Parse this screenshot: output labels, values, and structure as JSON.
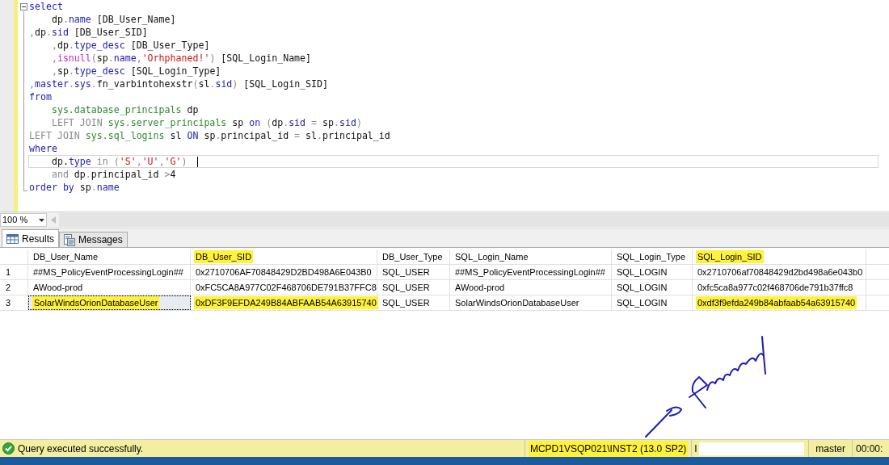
{
  "editor": {
    "lines": [
      {
        "current": false,
        "tokens": [
          {
            "kind": "keyword",
            "text": "select"
          }
        ]
      },
      {
        "current": false,
        "tokens": [
          {
            "kind": "plain",
            "text": "    dp"
          },
          {
            "kind": "gray",
            "text": "."
          },
          {
            "kind": "keyword",
            "text": "name"
          },
          {
            "kind": "plain",
            "text": " [DB_User_Name]"
          }
        ]
      },
      {
        "current": false,
        "tokens": [
          {
            "kind": "gray",
            "text": ","
          },
          {
            "kind": "plain",
            "text": "dp"
          },
          {
            "kind": "gray",
            "text": "."
          },
          {
            "kind": "keyword",
            "text": "sid"
          },
          {
            "kind": "plain",
            "text": " [DB_User_SID]"
          }
        ]
      },
      {
        "current": false,
        "tokens": [
          {
            "kind": "gray",
            "text": "    ,"
          },
          {
            "kind": "plain",
            "text": "dp"
          },
          {
            "kind": "gray",
            "text": "."
          },
          {
            "kind": "keyword",
            "text": "type_desc"
          },
          {
            "kind": "plain",
            "text": " [DB_User_Type]"
          }
        ]
      },
      {
        "current": false,
        "tokens": [
          {
            "kind": "gray",
            "text": "    ,"
          },
          {
            "kind": "function",
            "text": "isnull"
          },
          {
            "kind": "gray",
            "text": "("
          },
          {
            "kind": "plain",
            "text": "sp"
          },
          {
            "kind": "gray",
            "text": "."
          },
          {
            "kind": "keyword",
            "text": "name"
          },
          {
            "kind": "gray",
            "text": ","
          },
          {
            "kind": "string",
            "text": "'Orhphaned!'"
          },
          {
            "kind": "gray",
            "text": ")"
          },
          {
            "kind": "plain",
            "text": " [SQL_Login_Name]"
          }
        ]
      },
      {
        "current": false,
        "tokens": [
          {
            "kind": "gray",
            "text": "    ,"
          },
          {
            "kind": "plain",
            "text": "sp"
          },
          {
            "kind": "gray",
            "text": "."
          },
          {
            "kind": "keyword",
            "text": "type_desc"
          },
          {
            "kind": "plain",
            "text": " [SQL_Login_Type]"
          }
        ]
      },
      {
        "current": false,
        "tokens": [
          {
            "kind": "gray",
            "text": ","
          },
          {
            "kind": "keyword",
            "text": "master"
          },
          {
            "kind": "gray",
            "text": "."
          },
          {
            "kind": "keyword",
            "text": "sys"
          },
          {
            "kind": "gray",
            "text": "."
          },
          {
            "kind": "plain",
            "text": "fn_varbintohexstr"
          },
          {
            "kind": "gray",
            "text": "("
          },
          {
            "kind": "plain",
            "text": "sl"
          },
          {
            "kind": "gray",
            "text": "."
          },
          {
            "kind": "keyword",
            "text": "sid"
          },
          {
            "kind": "gray",
            "text": ")"
          },
          {
            "kind": "plain",
            "text": " [SQL_Login_SID]"
          }
        ]
      },
      {
        "current": false,
        "tokens": [
          {
            "kind": "keyword",
            "text": "from"
          }
        ]
      },
      {
        "current": false,
        "tokens": [
          {
            "kind": "system",
            "text": "    sys.database_principals"
          },
          {
            "kind": "plain",
            "text": " dp"
          }
        ]
      },
      {
        "current": false,
        "tokens": [
          {
            "kind": "gray",
            "text": "    LEFT JOIN"
          },
          {
            "kind": "system",
            "text": " sys.server_principals"
          },
          {
            "kind": "plain",
            "text": " sp "
          },
          {
            "kind": "keyword",
            "text": "on"
          },
          {
            "kind": "gray",
            "text": " ("
          },
          {
            "kind": "plain",
            "text": "dp"
          },
          {
            "kind": "gray",
            "text": "."
          },
          {
            "kind": "keyword",
            "text": "sid"
          },
          {
            "kind": "gray",
            "text": " = "
          },
          {
            "kind": "plain",
            "text": "sp"
          },
          {
            "kind": "gray",
            "text": "."
          },
          {
            "kind": "keyword",
            "text": "sid"
          },
          {
            "kind": "gray",
            "text": ")"
          }
        ]
      },
      {
        "current": false,
        "tokens": [
          {
            "kind": "gray",
            "text": "LEFT JOIN"
          },
          {
            "kind": "system",
            "text": " sys.sql_logins"
          },
          {
            "kind": "plain",
            "text": " sl "
          },
          {
            "kind": "keyword",
            "text": "ON"
          },
          {
            "kind": "plain",
            "text": " sp"
          },
          {
            "kind": "gray",
            "text": "."
          },
          {
            "kind": "plain",
            "text": "principal_id"
          },
          {
            "kind": "gray",
            "text": " = "
          },
          {
            "kind": "plain",
            "text": "sl"
          },
          {
            "kind": "gray",
            "text": "."
          },
          {
            "kind": "plain",
            "text": "principal_id"
          }
        ]
      },
      {
        "current": false,
        "tokens": [
          {
            "kind": "keyword",
            "text": "where"
          }
        ]
      },
      {
        "current": true,
        "tokens": [
          {
            "kind": "plain",
            "text": "    dp."
          },
          {
            "kind": "keyword",
            "text": "type"
          },
          {
            "kind": "gray",
            "text": " in ("
          },
          {
            "kind": "string",
            "text": "'S'"
          },
          {
            "kind": "gray",
            "text": ","
          },
          {
            "kind": "string",
            "text": "'U'"
          },
          {
            "kind": "gray",
            "text": ","
          },
          {
            "kind": "string",
            "text": "'G'"
          },
          {
            "kind": "gray",
            "text": ")"
          }
        ]
      },
      {
        "current": false,
        "tokens": [
          {
            "kind": "gray",
            "text": "    and"
          },
          {
            "kind": "plain",
            "text": " dp"
          },
          {
            "kind": "gray",
            "text": "."
          },
          {
            "kind": "plain",
            "text": "principal_id"
          },
          {
            "kind": "gray",
            "text": " >"
          },
          {
            "kind": "plain",
            "text": "4"
          }
        ]
      },
      {
        "current": false,
        "tokens": [
          {
            "kind": "keyword",
            "text": "order by"
          },
          {
            "kind": "plain",
            "text": " sp"
          },
          {
            "kind": "gray",
            "text": "."
          },
          {
            "kind": "keyword",
            "text": "name"
          }
        ]
      }
    ]
  },
  "zoom": {
    "value": "100 %"
  },
  "tabs": [
    {
      "label": "Results",
      "selected": true
    },
    {
      "label": "Messages",
      "selected": false
    }
  ],
  "grid": {
    "columns": [
      {
        "text": "DB_User_Name",
        "highlighted": false
      },
      {
        "text": "DB_User_SID",
        "highlighted": true
      },
      {
        "text": "DB_User_Type",
        "highlighted": false
      },
      {
        "text": "SQL_Login_Name",
        "highlighted": false
      },
      {
        "text": "SQL_Login_Type",
        "highlighted": false
      },
      {
        "text": "SQL_Login_SID",
        "highlighted": true
      }
    ],
    "rows": [
      {
        "number": "1",
        "cells": [
          {
            "text": "##MS_PolicyEventProcessingLogin##",
            "highlighted": false,
            "selected": false
          },
          {
            "text": "0x2710706AF70848429D2BD498A6E043B0",
            "highlighted": false,
            "selected": false
          },
          {
            "text": "SQL_USER",
            "highlighted": false,
            "selected": false
          },
          {
            "text": "##MS_PolicyEventProcessingLogin##",
            "highlighted": false,
            "selected": false
          },
          {
            "text": "SQL_LOGIN",
            "highlighted": false,
            "selected": false
          },
          {
            "text": "0x2710706af70848429d2bd498a6e043b0",
            "highlighted": false,
            "selected": false
          }
        ]
      },
      {
        "number": "2",
        "cells": [
          {
            "text": "AWood-prod",
            "highlighted": false,
            "selected": false
          },
          {
            "text": "0xFC5CA8A977C02F468706DE791B37FFC8",
            "highlighted": false,
            "selected": false
          },
          {
            "text": "SQL_USER",
            "highlighted": false,
            "selected": false
          },
          {
            "text": "AWood-prod",
            "highlighted": false,
            "selected": false
          },
          {
            "text": "SQL_LOGIN",
            "highlighted": false,
            "selected": false
          },
          {
            "text": "0xfc5ca8a977c02f468706de791b37ffc8",
            "highlighted": false,
            "selected": false
          }
        ]
      },
      {
        "number": "3",
        "cells": [
          {
            "text": "SolarWindsOrionDatabaseUser",
            "highlighted": true,
            "selected": true
          },
          {
            "text": "0xDF3F9EFDA249B84ABFAAB54A63915740",
            "highlighted": true,
            "selected": false
          },
          {
            "text": "SQL_USER",
            "highlighted": false,
            "selected": false
          },
          {
            "text": "SolarWindsOrionDatabaseUser",
            "highlighted": false,
            "selected": false
          },
          {
            "text": "SQL_LOGIN",
            "highlighted": false,
            "selected": false
          },
          {
            "text": "0xdf3f9efda249b84abfaab54a63915740",
            "highlighted": true,
            "selected": false
          }
        ]
      }
    ]
  },
  "status_bar": {
    "message": "Query executed successfully.",
    "server": {
      "text": "MCPD1VSQP021\\INST2 (13.0 SP2)",
      "highlighted": true
    },
    "user": "I",
    "database": "master",
    "elapsed": "00:00:"
  }
}
